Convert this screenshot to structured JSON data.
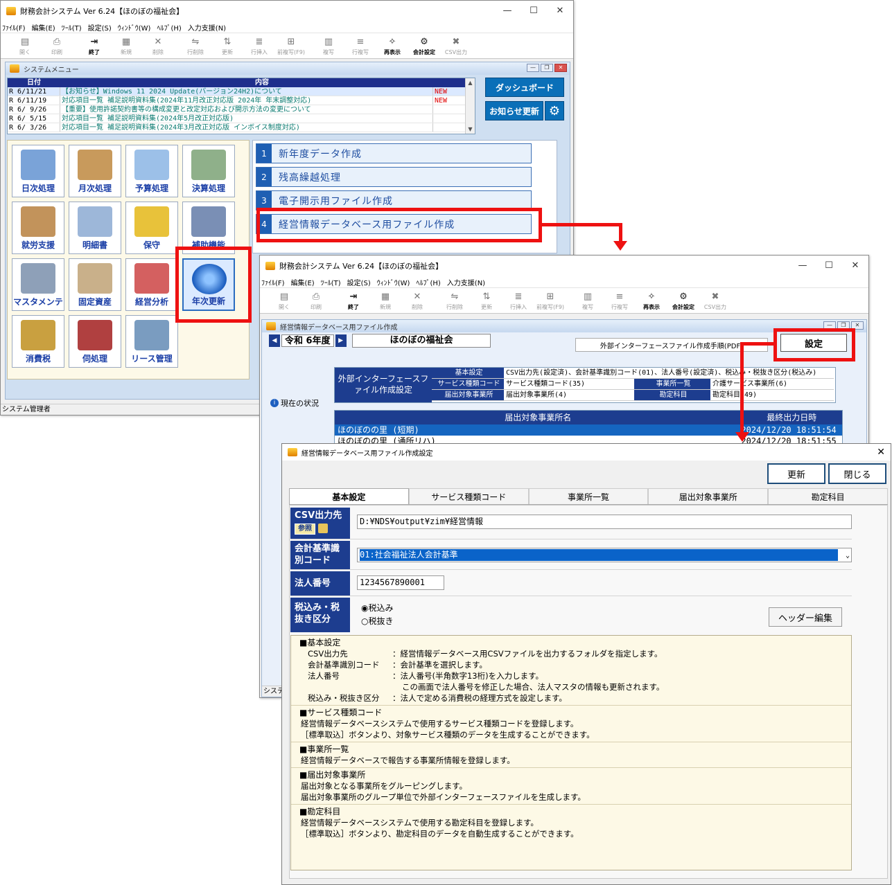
{
  "main_window": {
    "title": "財務会計システム Ver 6.24【ほのぼの福祉会】",
    "menu": [
      "ﾌｧｲﾙ(F)",
      "編集(E)",
      "ﾂｰﾙ(T)",
      "設定(S)",
      "ｳｨﾝﾄﾞｳ(W)",
      "ﾍﾙﾌﾟ(H)",
      "入力支援(N)"
    ],
    "toolbar": [
      {
        "label": "開く",
        "icon": "open-icon",
        "active": false
      },
      {
        "label": "印刷",
        "icon": "print-icon",
        "active": false
      },
      {
        "label": "終了",
        "icon": "exit-icon",
        "active": true
      },
      {
        "label": "新規",
        "icon": "new-icon",
        "active": false
      },
      {
        "label": "削除",
        "icon": "delete-icon",
        "active": false
      },
      {
        "label": "行削除",
        "icon": "row-delete-icon",
        "active": false
      },
      {
        "label": "更新",
        "icon": "update-icon",
        "active": false
      },
      {
        "label": "行挿入",
        "icon": "row-insert-icon",
        "active": false
      },
      {
        "label": "前複写(F9)",
        "icon": "copy-prev-icon",
        "active": false
      },
      {
        "label": "複写",
        "icon": "copy-icon",
        "active": false
      },
      {
        "label": "行複写",
        "icon": "row-copy-icon",
        "active": false
      },
      {
        "label": "再表示",
        "icon": "refresh-icon",
        "active": true
      },
      {
        "label": "会計設定",
        "icon": "settings-icon",
        "active": true
      },
      {
        "label": "CSV出力",
        "icon": "csv-icon",
        "active": false
      }
    ],
    "status": "システム管理者"
  },
  "system_menu": {
    "title": "システムメニュー",
    "news_headers": [
      "日付",
      "内容"
    ],
    "news": [
      {
        "date": "R 6/11/21",
        "text": "【お知らせ】Windows 11 2024 Update(バージョン24H2)について",
        "badge": "NEW"
      },
      {
        "date": "R 6/11/19",
        "text": "対応項目一覧 補足説明資料集(2024年11月改正対応版 2024年 年末調整対応)",
        "badge": "NEW"
      },
      {
        "date": "R 6/ 9/26",
        "text": "【重要】使用許諾契約書等の構成変更と改定対応および開示方法の変更について",
        "badge": ""
      },
      {
        "date": "R 6/ 5/15",
        "text": "対応項目一覧 補足説明資料集(2024年5月改正対応版)",
        "badge": ""
      },
      {
        "date": "R 6/ 3/26",
        "text": "対応項目一覧 補足説明資料集(2024年3月改正対応版 インボイス制度対応)",
        "badge": ""
      }
    ],
    "dashboard": "ダッシュボード",
    "notice_update": "お知らせ更新",
    "tiles": [
      "日次処理",
      "月次処理",
      "予算処理",
      "決算処理",
      "就労支援",
      "明細書",
      "保守",
      "補助機能",
      "マスタメンテ",
      "固定資産",
      "経営分析",
      "年次更新",
      "消費税",
      "伺処理",
      "リース管理"
    ],
    "menu_items": [
      {
        "num": "1",
        "label": "新年度データ作成"
      },
      {
        "num": "2",
        "label": "残高繰越処理"
      },
      {
        "num": "3",
        "label": "電子開示用ファイル作成"
      },
      {
        "num": "4",
        "label": "経営情報データベース用ファイル作成"
      }
    ]
  },
  "second_window": {
    "title": "財務会計システム Ver 6.24【ほのぼの福祉会】",
    "form_title": "経営情報データベース用ファイル作成",
    "year": "令和 6年度",
    "corp": "ほのぼの福祉会",
    "pdf_button": "外部インターフェースファイル作成手順(PDF)",
    "settings_button": "設定",
    "status_label": "現在の状況",
    "group_label": "外部インターフェースファイル作成設定",
    "grid": [
      [
        "基本設定",
        "CSV出力先(設定済)、会計基準識別コード(01)、法人番号(設定済)、税込み・税抜き区分(税込み)"
      ],
      [
        "サービス種類コード",
        "サービス種類コード(35)",
        "事業所一覧",
        "介護サービス事業所(6)"
      ],
      [
        "届出対象事業所",
        "届出対象事業所(4)",
        "勘定科目",
        "勘定科目(49)"
      ]
    ],
    "list_headers": [
      "届出対象事業所名",
      "最終出力日時"
    ],
    "list_rows": [
      {
        "name": "ほのぼのの里 (短期)",
        "time": "2024/12/20 18:51:54"
      },
      {
        "name": "ほのぼのの里 (通所リハ)",
        "time": "2024/12/20 18:51:55"
      }
    ],
    "status": "システム"
  },
  "dialog": {
    "title": "経営情報データベース用ファイル作成設定",
    "update": "更新",
    "close": "閉じる",
    "tabs": [
      "基本設定",
      "サービス種類コード",
      "事業所一覧",
      "届出対象事業所",
      "勘定科目"
    ],
    "csv_label": "CSV出力先",
    "browse": "参照",
    "csv_path": "D:¥NDS¥output¥zim¥経営情報",
    "standard_label": "会計基準識別コード",
    "standard_value": "01:社会福祉法人会計基準",
    "corp_no_label": "法人番号",
    "corp_no": "1234567890001",
    "tax_label": "税込み・税抜き区分",
    "tax_options": [
      "税込み",
      "税抜き"
    ],
    "header_edit": "ヘッダー編集",
    "help": {
      "s1_title": "■基本設定",
      "s1_lines": [
        {
          "k": "CSV出力先",
          "v": "：経営情報データベース用CSVファイルを出力するフォルダを指定します。"
        },
        {
          "k": "会計基準識別コード",
          "v": "：会計基準を選択します。"
        },
        {
          "k": "法人番号",
          "v": "：法人番号(半角数字13桁)を入力します。"
        },
        {
          "k": "",
          "v": "この画面で法人番号を修正した場合、法人マスタの情報も更新されます。"
        },
        {
          "k": "税込み・税抜き区分",
          "v": "：法人で定める消費税の経理方式を設定します。"
        }
      ],
      "s2_title": "■サービス種類コード",
      "s2_lines": [
        "経営情報データベースシステムで使用するサービス種類コードを登録します。",
        "［標準取込］ボタンより、対象サービス種類のデータを生成することができます。"
      ],
      "s3_title": "■事業所一覧",
      "s3_lines": [
        "経営情報データベースで報告する事業所情報を登録します。"
      ],
      "s4_title": "■届出対象事業所",
      "s4_lines": [
        "届出対象となる事業所をグルーピングします。",
        "届出対象事業所のグループ単位で外部インターフェースファイルを生成します。"
      ],
      "s5_title": "■勘定科目",
      "s5_lines": [
        "経営情報データベースシステムで使用する勘定科目を登録します。",
        "［標準取込］ボタンより、勘定科目のデータを自動生成することができます。"
      ]
    }
  }
}
